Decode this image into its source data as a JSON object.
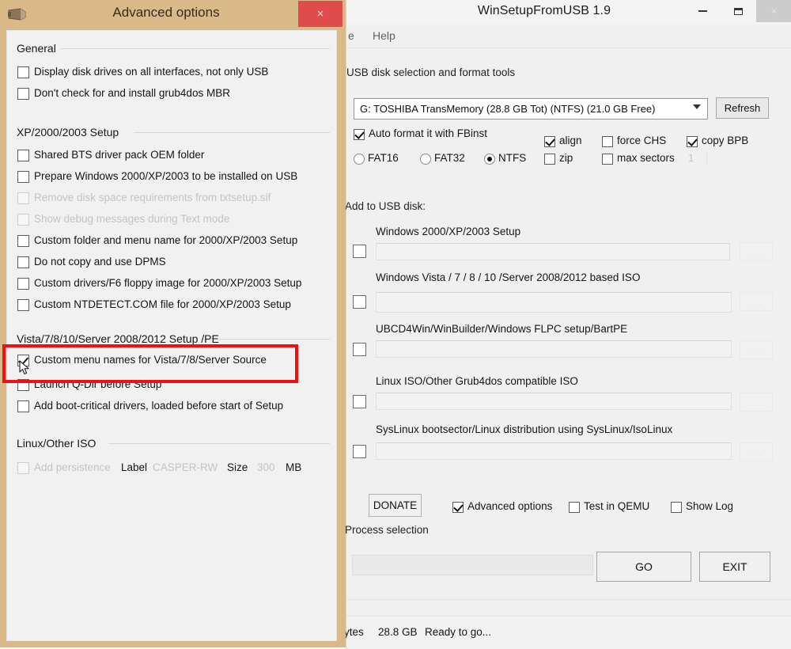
{
  "main_window": {
    "title": "WinSetupFromUSB 1.9",
    "controls": {
      "minimize": "–",
      "maximize": "❐",
      "close": "×"
    },
    "menu": [
      {
        "label": "e"
      },
      {
        "label": "Help"
      }
    ],
    "usb_section": {
      "label": "USB disk selection and format tools",
      "drive_value": "G: TOSHIBA TransMemory (28.8 GB Tot) (NTFS) (21.0 GB Free)",
      "refresh_label": "Refresh",
      "auto_format": {
        "label": "Auto format it with FBinst",
        "checked": true
      },
      "filesystems": [
        {
          "label": "FAT16",
          "selected": false
        },
        {
          "label": "FAT32",
          "selected": false
        },
        {
          "label": "NTFS",
          "selected": true
        }
      ],
      "flags": [
        {
          "label": "align",
          "checked": true
        },
        {
          "label": "zip",
          "checked": false
        },
        {
          "label": "force CHS",
          "checked": false
        },
        {
          "label": "max sectors",
          "checked": false
        },
        {
          "label": "copy BPB",
          "checked": true
        }
      ],
      "max_sectors_value": "1"
    },
    "add_section": {
      "label": "Add to USB disk:",
      "rows": [
        {
          "title": "Windows 2000/XP/2003 Setup",
          "checked": false,
          "value": "",
          "browse_label": "..."
        },
        {
          "title": "Windows Vista / 7 / 8 / 10 /Server 2008/2012 based ISO",
          "checked": false,
          "value": "",
          "browse_label": "..."
        },
        {
          "title": "UBCD4Win/WinBuilder/Windows FLPC setup/BartPE",
          "checked": false,
          "value": "",
          "browse_label": "..."
        },
        {
          "title": "Linux ISO/Other Grub4dos compatible ISO",
          "checked": false,
          "value": "",
          "browse_label": "..."
        },
        {
          "title": "SysLinux bootsector/Linux distribution using SysLinux/IsoLinux",
          "checked": false,
          "value": "",
          "browse_label": "..."
        }
      ]
    },
    "bottom": {
      "donate_label": "DONATE",
      "toggles": [
        {
          "label": "Advanced options",
          "checked": true
        },
        {
          "label": "Test in QEMU",
          "checked": false
        },
        {
          "label": "Show Log",
          "checked": false
        }
      ],
      "process_label": "Process selection",
      "progress_value": "",
      "go_label": "GO",
      "exit_label": "EXIT"
    },
    "status_bar": {
      "bytes": "ytes",
      "size": "28.8 GB",
      "message": "Ready to go..."
    }
  },
  "advanced_window": {
    "title": "Advanced options",
    "close_label": "×",
    "titlebar_color": "#d9b987",
    "close_color": "#e04b4b",
    "highlight_color": "#ee1111",
    "groups": [
      {
        "label": "General",
        "items": [
          {
            "label": "Display disk drives on all interfaces, not only USB",
            "checked": false,
            "disabled": false
          },
          {
            "label": "Don't check for and install grub4dos MBR",
            "checked": false,
            "disabled": false
          }
        ]
      },
      {
        "label": "XP/2000/2003 Setup",
        "items": [
          {
            "label": "Shared BTS driver pack OEM folder",
            "checked": false,
            "disabled": false
          },
          {
            "label": "Prepare Windows 2000/XP/2003 to be installed on USB",
            "checked": false,
            "disabled": false
          },
          {
            "label": "Remove disk space requirements from txtsetup.sif",
            "checked": false,
            "disabled": true
          },
          {
            "label": "Show debug messages during Text mode",
            "checked": false,
            "disabled": true
          },
          {
            "label": "Custom folder and menu name for 2000/XP/2003 Setup",
            "checked": false,
            "disabled": false
          },
          {
            "label": "Do not copy and use DPMS",
            "checked": false,
            "disabled": false
          },
          {
            "label": "Custom drivers/F6 floppy image for 2000/XP/2003 Setup",
            "checked": false,
            "disabled": false
          },
          {
            "label": "Custom NTDETECT.COM file for 2000/XP/2003 Setup",
            "checked": false,
            "disabled": false
          }
        ]
      },
      {
        "label": "Vista/7/8/10/Server 2008/2012 Setup /PE",
        "items": [
          {
            "label": "Custom menu names for Vista/7/8/Server Source",
            "checked": true,
            "disabled": false,
            "highlighted": true
          },
          {
            "label": "Launch Q-Dir before Setup",
            "checked": false,
            "disabled": false
          },
          {
            "label": "Add boot-critical drivers, loaded before start of Setup",
            "checked": false,
            "disabled": false
          }
        ]
      },
      {
        "label": "Linux/Other ISO",
        "items": [
          {
            "label": "Add persistence",
            "checked": false,
            "disabled": true
          }
        ],
        "persistence": {
          "label_caption": "Label",
          "label_value": "CASPER-RW",
          "size_caption": "Size",
          "size_value": "300",
          "size_unit": "MB"
        }
      }
    ]
  }
}
